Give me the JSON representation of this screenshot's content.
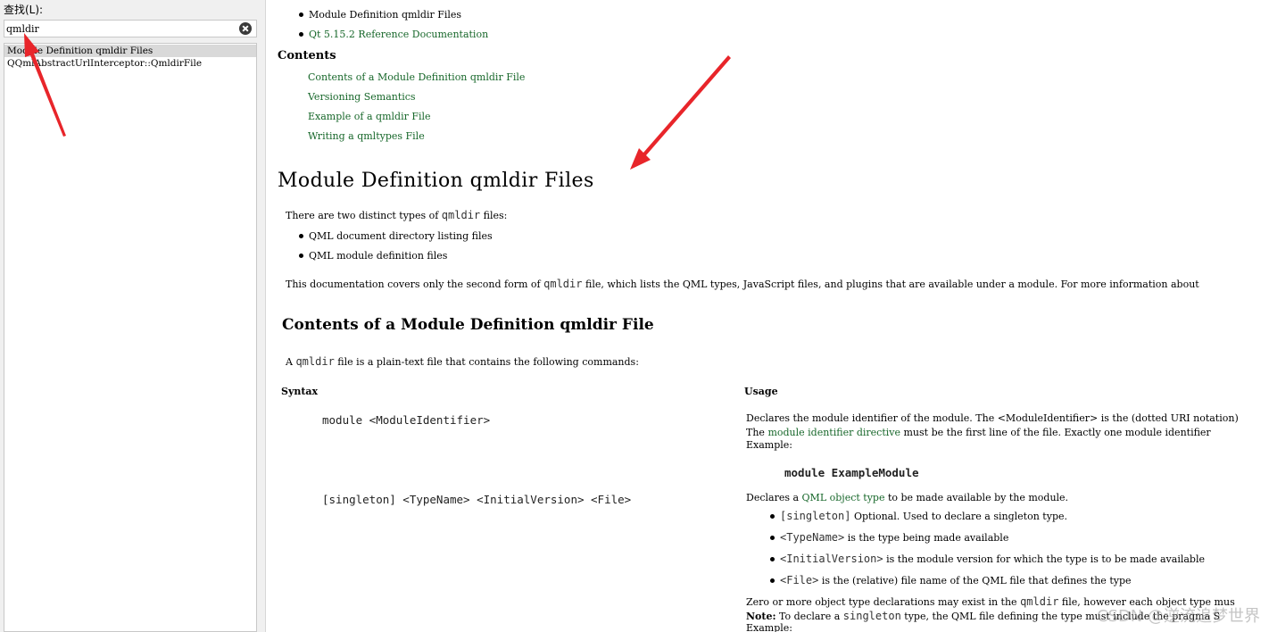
{
  "index_panel": {
    "search_label": "查找(L):",
    "search_value": "qmldir",
    "results": [
      "Module Definition qmldir Files",
      "QQmlAbstractUrlInterceptor::QmldirFile"
    ]
  },
  "doc": {
    "top_links": {
      "item1": "Module Definition qmldir Files",
      "item2": "Qt 5.15.2 Reference Documentation"
    },
    "contents_heading": "Contents",
    "contents": [
      "Contents of a Module Definition qmldir File",
      "Versioning Semantics",
      "Example of a qmldir File",
      "Writing a qmltypes File"
    ],
    "title": "Module Definition qmldir Files",
    "intro": {
      "before": "There are two distinct types of ",
      "code": "qmldir",
      "after": " files:"
    },
    "types": [
      "QML document directory listing files",
      "QML module definition files"
    ],
    "coverage": {
      "before": "This documentation covers only the second form of ",
      "code": "qmldir",
      "after": " file, which lists the QML types, JavaScript files, and plugins that are available under a module. For more information about"
    },
    "section_title": "Contents of a Module Definition qmldir File",
    "section_intro": {
      "before": "A ",
      "code": "qmldir",
      "after": " file is a plain-text file that contains the following commands:"
    },
    "table": {
      "col_syntax": "Syntax",
      "col_usage": "Usage",
      "row1": {
        "syntax": "module <ModuleIdentifier>",
        "usage_line1": "Declares the module identifier of the module. The <ModuleIdentifier> is the (dotted URI notation)",
        "usage_line2_before": "The ",
        "usage_line2_link": "module identifier directive",
        "usage_line2_after": " must be the first line of the file. Exactly one module identifier",
        "usage_line3": "Example:",
        "example": "module ExampleModule"
      },
      "row2": {
        "syntax": "[singleton] <TypeName> <InitialVersion> <File>",
        "usage_before": "Declares a ",
        "usage_link": "QML object type",
        "usage_after": " to be made available by the module.",
        "bullets": [
          {
            "code": "[singleton]",
            "text": " Optional. Used to declare a singleton type."
          },
          {
            "code": "<TypeName>",
            "text": " is the type being made available"
          },
          {
            "code": "<InitialVersion>",
            "text": " is the module version for which the type is to be made available"
          },
          {
            "code": "<File>",
            "text": " is the (relative) file name of the QML file that defines the type"
          }
        ],
        "zero_before": "Zero or more object type declarations may exist in the ",
        "zero_code": "qmldir",
        "zero_after": " file, however each object type mus",
        "note_label": "Note:",
        "note_before": " To declare a ",
        "note_code": "singleton",
        "note_after": " type, the QML file defining the type must include the pragma S",
        "example_label": "Example:"
      }
    }
  },
  "watermark": "CSDN @逆流追梦世界"
}
